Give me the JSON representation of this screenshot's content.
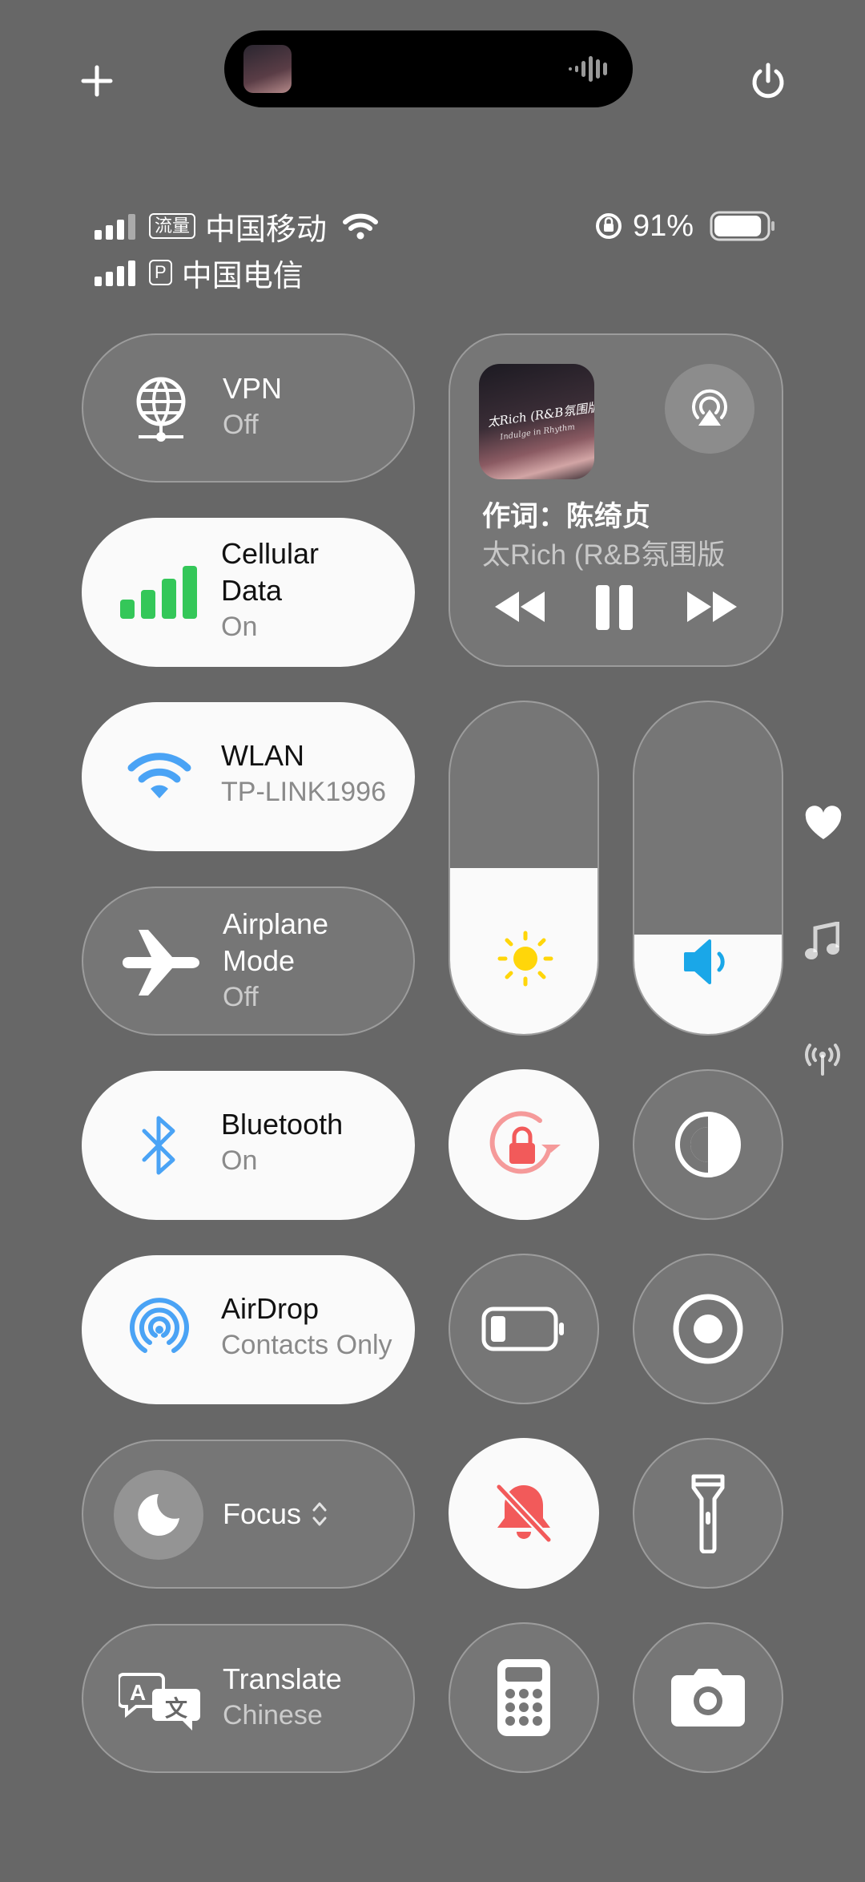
{
  "top": {
    "plus_icon": "plus-icon",
    "power_icon": "power-icon"
  },
  "status": {
    "line1": {
      "badge": "流量",
      "carrier": "中国移动"
    },
    "line2": {
      "badge": "P",
      "carrier": "中国电信"
    },
    "battery_percent": "91%",
    "battery_level": 0.91
  },
  "tiles": {
    "vpn": {
      "title": "VPN",
      "sub": "Off"
    },
    "cellular": {
      "title": "Cellular Data",
      "title1": "Cellular",
      "title2": "Data",
      "sub": "On"
    },
    "wlan": {
      "title": "WLAN",
      "sub": "TP-LINK1996"
    },
    "airplane": {
      "title": "Airplane Mode",
      "title1": "Airplane",
      "title2": "Mode",
      "sub": "Off"
    },
    "bluetooth": {
      "title": "Bluetooth",
      "sub": "On"
    },
    "airdrop": {
      "title": "AirDrop",
      "sub": "Contacts Only"
    },
    "focus": {
      "title": "Focus"
    },
    "translate": {
      "title": "Translate",
      "sub": "Chinese"
    }
  },
  "media": {
    "artwork_label": "太Rich (R&B氛围版)",
    "artwork_sub": "Indulge in Rhythm",
    "line1": "作词：陈绮贞",
    "line2": "太Rich (R&B氛围版"
  },
  "sliders": {
    "brightness_level": 0.5,
    "volume_level": 0.3
  },
  "colors": {
    "background": "#676767",
    "green": "#34c759",
    "blue": "#4aa3f5",
    "red": "#f25a5a",
    "yellow": "#ffd60a"
  }
}
